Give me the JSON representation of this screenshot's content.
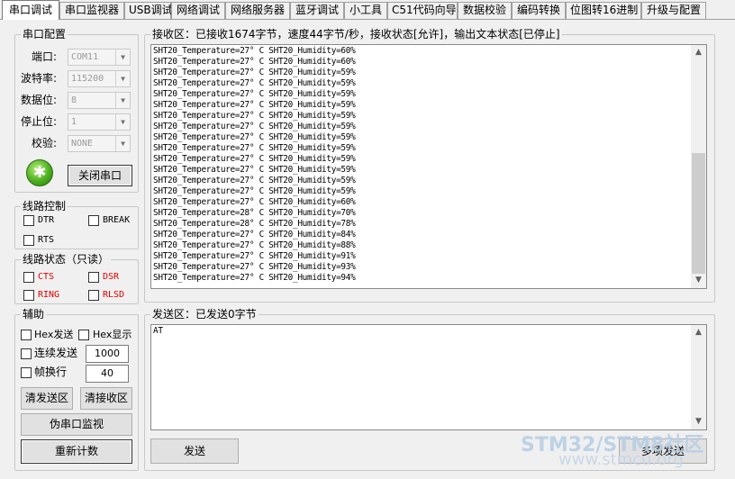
{
  "tabs": [
    {
      "label": "串口调试",
      "active": true
    },
    {
      "label": "串口监视器"
    },
    {
      "label": "USB调试"
    },
    {
      "label": "网络调试"
    },
    {
      "label": "网络服务器"
    },
    {
      "label": "蓝牙调试"
    },
    {
      "label": "小工具"
    },
    {
      "label": "C51代码向导"
    },
    {
      "label": "数据校验"
    },
    {
      "label": "编码转换"
    },
    {
      "label": "位图转16进制"
    },
    {
      "label": "升级与配置"
    }
  ],
  "port_config": {
    "title": "串口配置",
    "port_label": "端口:",
    "port_value": "COM11",
    "baud_label": "波特率:",
    "baud_value": "115200",
    "data_bits_label": "数据位:",
    "data_bits_value": "8",
    "stop_bits_label": "停止位:",
    "stop_bits_value": "1",
    "parity_label": "校验:",
    "parity_value": "NONE",
    "close_button": "关闭串口",
    "status_icon": "serial-open-icon"
  },
  "line_control": {
    "title": "线路控制",
    "dtr": "DTR",
    "break": "BREAK",
    "rts": "RTS"
  },
  "line_status": {
    "title": "线路状态（只读）",
    "cts": "CTS",
    "dsr": "DSR",
    "ring": "RING",
    "rlsd": "RLSD"
  },
  "assist": {
    "title": "辅助",
    "hex_send": "Hex发送",
    "hex_show": "Hex显示",
    "continuous_send": "连续发送",
    "interval_value": "1000",
    "frame_break": "帧换行",
    "frame_value": "40",
    "clear_send": "清发送区",
    "clear_receive": "清接收区",
    "pseudo_monitor": "伪串口监视",
    "recount": "重新计数"
  },
  "receive": {
    "title": "接收区：已接收1674字节，速度44字节/秒，接收状态[允许]，输出文本状态[已停止]",
    "lines": [
      "SHT20_Temperature=27° C SHT20_Humidity=60%",
      "SHT20_Temperature=27° C SHT20_Humidity=60%",
      "SHT20_Temperature=27° C SHT20_Humidity=59%",
      "SHT20_Temperature=27° C SHT20_Humidity=59%",
      "SHT20_Temperature=27° C SHT20_Humidity=59%",
      "SHT20_Temperature=27° C SHT20_Humidity=59%",
      "SHT20_Temperature=27° C SHT20_Humidity=59%",
      "SHT20_Temperature=27° C SHT20_Humidity=59%",
      "SHT20_Temperature=27° C SHT20_Humidity=59%",
      "SHT20_Temperature=27° C SHT20_Humidity=59%",
      "SHT20_Temperature=27° C SHT20_Humidity=59%",
      "SHT20_Temperature=27° C SHT20_Humidity=59%",
      "SHT20_Temperature=27° C SHT20_Humidity=59%",
      "SHT20_Temperature=27° C SHT20_Humidity=59%",
      "SHT20_Temperature=27° C SHT20_Humidity=60%",
      "SHT20_Temperature=28° C SHT20_Humidity=70%",
      "SHT20_Temperature=28° C SHT20_Humidity=78%",
      "SHT20_Temperature=27° C SHT20_Humidity=84%",
      "SHT20_Temperature=27° C SHT20_Humidity=88%",
      "SHT20_Temperature=27° C SHT20_Humidity=91%",
      "SHT20_Temperature=27° C SHT20_Humidity=93%",
      "SHT20_Temperature=27° C SHT20_Humidity=94%"
    ]
  },
  "send": {
    "title": "发送区：已发送0字节",
    "text": "AT",
    "send_button": "发送",
    "multi_send_button": "多项发送"
  },
  "watermark": {
    "line1": "STM32/STM8社区",
    "line2": "www.stmcu.org"
  }
}
